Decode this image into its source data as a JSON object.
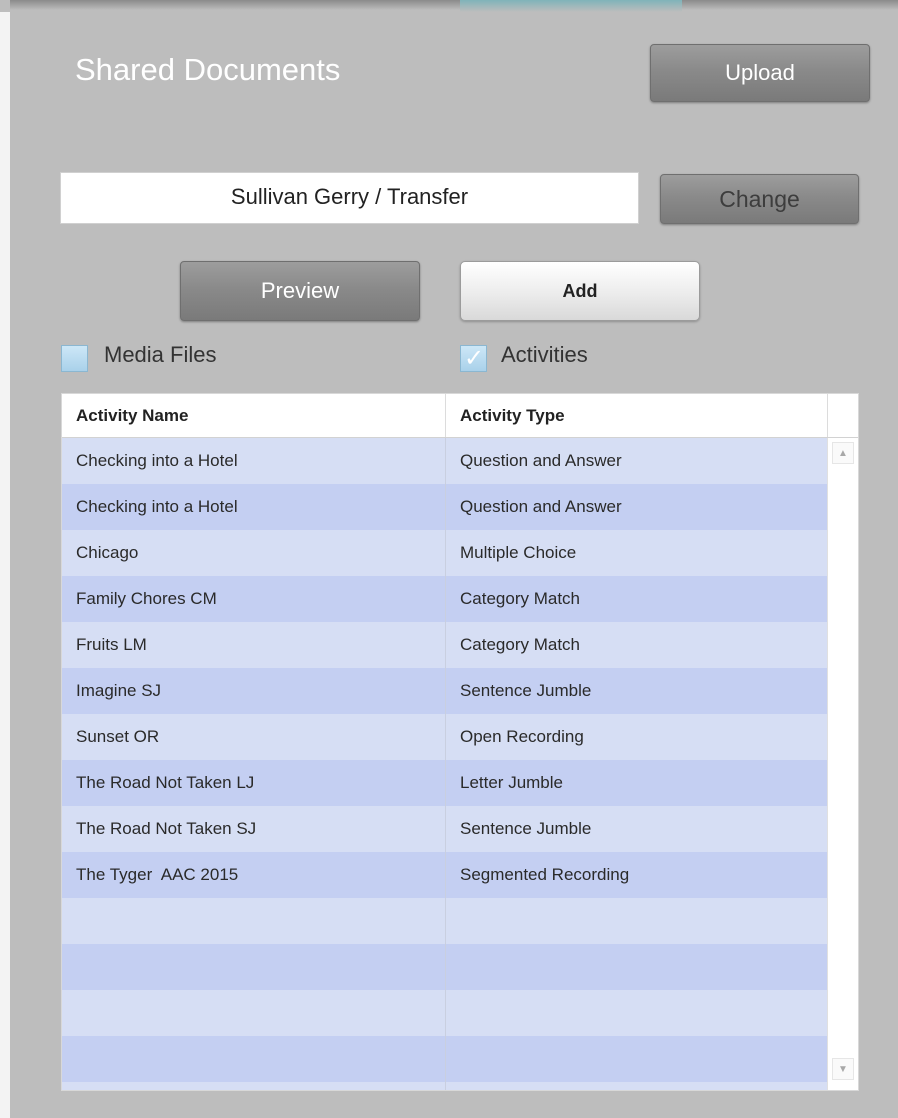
{
  "header": {
    "title": "Shared Documents",
    "upload_label": "Upload"
  },
  "folder": {
    "path": "Sullivan Gerry / Transfer",
    "change_label": "Change"
  },
  "actions": {
    "preview_label": "Preview",
    "add_label": "Add"
  },
  "filters": {
    "media_files": {
      "label": "Media Files",
      "checked": false
    },
    "activities": {
      "label": "Activities",
      "checked": true
    }
  },
  "table": {
    "columns": [
      "Activity Name",
      "Activity Type"
    ],
    "rows": [
      {
        "name": "Checking into a Hotel",
        "type": "Question and Answer"
      },
      {
        "name": "Checking into a Hotel",
        "type": "Question and Answer"
      },
      {
        "name": "Chicago",
        "type": "Multiple Choice"
      },
      {
        "name": "Family Chores CM",
        "type": "Category Match"
      },
      {
        "name": "Fruits LM",
        "type": "Category Match"
      },
      {
        "name": "Imagine SJ",
        "type": "Sentence Jumble"
      },
      {
        "name": "Sunset OR",
        "type": "Open Recording"
      },
      {
        "name": "The Road Not Taken LJ",
        "type": "Letter Jumble"
      },
      {
        "name": "The Road Not Taken SJ",
        "type": "Sentence Jumble"
      },
      {
        "name": "The Tyger  AAC 2015",
        "type": "Segmented Recording"
      },
      {
        "name": "",
        "type": ""
      },
      {
        "name": "",
        "type": ""
      },
      {
        "name": "",
        "type": ""
      },
      {
        "name": "",
        "type": ""
      }
    ]
  },
  "colors": {
    "background": "#bdbdbd",
    "row_light": "#d6def4",
    "row_dark": "#c4cff2",
    "checkbox": "#a9d1ea"
  },
  "icons": {
    "scroll_up": "scroll-up-arrow-icon",
    "scroll_down": "scroll-down-arrow-icon",
    "checkmark": "checkmark-icon"
  }
}
